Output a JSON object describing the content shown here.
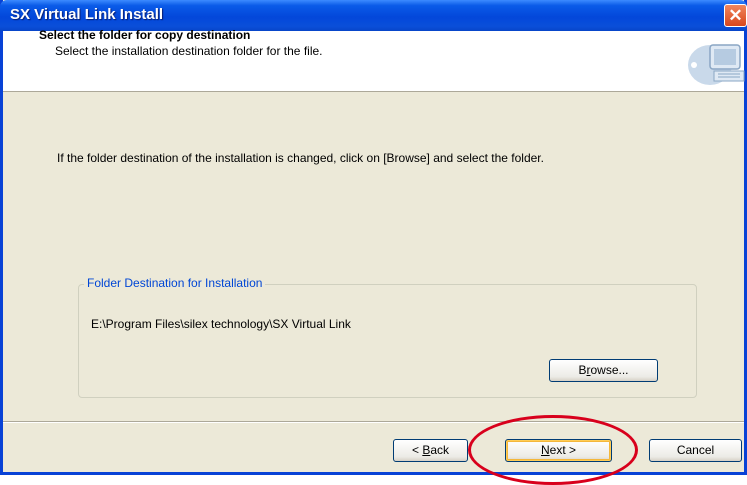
{
  "window": {
    "title": "SX Virtual Link Install",
    "close_glyph": "✕"
  },
  "header": {
    "title": "Select the folder for copy destination",
    "subtitle": "Select the installation destination folder for the file.",
    "icon": "computer-monitor-icon"
  },
  "body": {
    "instruction": "If the folder destination of the installation is changed, click on [Browse] and select the folder.",
    "group_label": "Folder Destination for Installation",
    "path": "E:\\Program Files\\silex technology\\SX Virtual Link"
  },
  "buttons": {
    "browse_pre": "B",
    "browse_ul": "r",
    "browse_post": "owse...",
    "back_pre": "< ",
    "back_ul": "B",
    "back_post": "ack",
    "next_pre": "",
    "next_ul": "N",
    "next_post": "ext >",
    "cancel": "Cancel"
  },
  "colors": {
    "titlebar": "#0a4fd9",
    "group_label": "#0046d5",
    "highlight": "#d8001c"
  }
}
